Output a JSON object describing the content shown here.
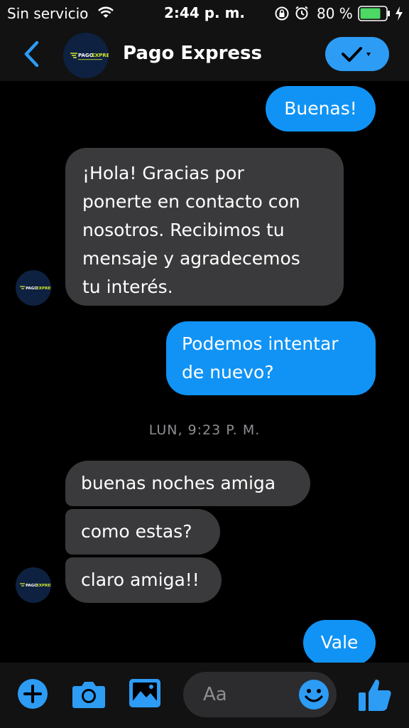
{
  "status_bar": {
    "carrier": "Sin servicio",
    "time": "2:44 p. m.",
    "battery_percent": "80 %",
    "battery_level": 0.8,
    "battery_color": "#4cd964"
  },
  "header": {
    "title": "Pago Express",
    "avatar_logo_text": "PAGO EXPRESS",
    "back_icon": "chevron-left-icon",
    "action_icon": "checkmark-dropdown-icon"
  },
  "messages": [
    {
      "from": "me",
      "text": "Buenas!"
    },
    {
      "from": "them",
      "lines": [
        "¡Hola! Gracias por",
        "ponerte en contacto con",
        "nosotros. Recibimos tu",
        "mensaje y agradecemos",
        "tu interés."
      ]
    },
    {
      "from": "me",
      "lines": [
        "Podemos intentar",
        "de nuevo?"
      ]
    },
    {
      "from": "them",
      "text": "buenas noches amiga"
    },
    {
      "from": "them",
      "text": "como estas?"
    },
    {
      "from": "them",
      "text": "claro amiga!!"
    },
    {
      "from": "me",
      "text": "Vale"
    }
  ],
  "timestamp": "LUN, 9:23 P. M.",
  "composer": {
    "placeholder": "Aa",
    "icons": [
      "plus-icon",
      "camera-icon",
      "photo-icon",
      "emoji-icon",
      "thumbs-up-icon"
    ]
  },
  "colors": {
    "accent": "#2d9cf5",
    "outgoing_bubble": "#1093f5",
    "incoming_bubble": "#3a3a3c",
    "background": "#000000"
  }
}
